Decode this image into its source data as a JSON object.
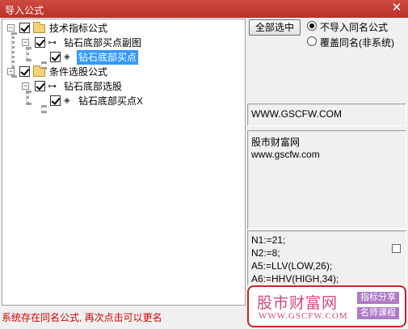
{
  "window": {
    "title": "导入公式",
    "close_glyph": "✕"
  },
  "tree": {
    "nodes": [
      {
        "label": "技术指标公式"
      },
      {
        "label": "钻石底部买点副图"
      },
      {
        "label": "钻石底部买点"
      },
      {
        "label": "条件选股公式"
      },
      {
        "label": "钻石底部选股"
      },
      {
        "label": "钻石底部买点X"
      }
    ],
    "expander_glyph": "−",
    "key_glyph": "⊶",
    "diamond_glyph": "◈"
  },
  "actions": {
    "select_all_label": "全部选中",
    "options": [
      {
        "label": "不导入同名公式",
        "checked": true
      },
      {
        "label": "覆盖同名(非系统)",
        "checked": false
      }
    ]
  },
  "info": {
    "source_url": "WWW.GSCFW.COM",
    "description": [
      "股市财富网",
      "www.gscfw.com"
    ],
    "formula_lines": [
      "N1:=21;",
      "N2:=8;",
      "A5:=LLV(LOW,26);",
      "A6:=HHV(HIGH,34);"
    ]
  },
  "banner": {
    "name": "股市财富网",
    "url": "WWW.GSCFW.COM",
    "tags": [
      "指标分享",
      "名师课程"
    ]
  },
  "status": {
    "message": "系统存在同名公式, 再次点击可以更名"
  }
}
